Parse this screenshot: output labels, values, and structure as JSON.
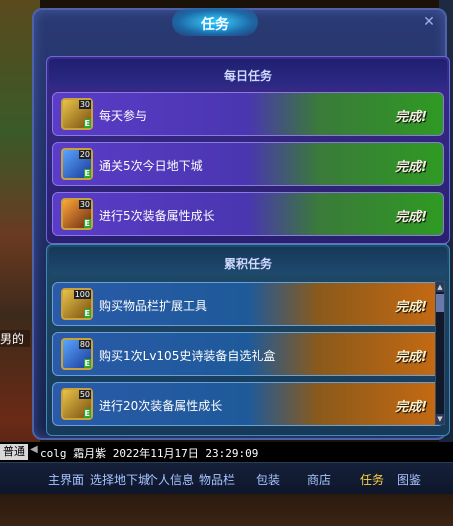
{
  "background": {
    "side_text": "男的"
  },
  "window": {
    "title": "任务"
  },
  "daily": {
    "title": "每日任务",
    "tasks": [
      {
        "icon": "gold-ticket-icon",
        "count": "30",
        "badge": "E",
        "name": "每天参与",
        "status": "完成!"
      },
      {
        "icon": "blue-crystal-icon",
        "count": "20",
        "badge": "E",
        "name": "通关5次今日地下城",
        "status": "完成!"
      },
      {
        "icon": "orange-armor-icon",
        "count": "30",
        "badge": "E",
        "name": "进行5次装备属性成长",
        "status": "完成!"
      }
    ]
  },
  "cumulative": {
    "title": "累积任务",
    "tasks": [
      {
        "icon": "gold-ticket-icon",
        "count": "100",
        "badge": "E",
        "name": "购买物品栏扩展工具",
        "status": "完成!"
      },
      {
        "icon": "blue-crystal-icon",
        "count": "80",
        "badge": "E",
        "name": "购买1次Lv105史诗装备自选礼盒",
        "status": "完成!"
      },
      {
        "icon": "gold-ticket-icon",
        "count": "50",
        "badge": "E",
        "name": "进行20次装备属性成长",
        "status": "完成!"
      }
    ]
  },
  "chat": {
    "channel": "普通",
    "text": "colg 霜月紫  2022年11月17日 23:29:09"
  },
  "nav": [
    "主界面",
    "选择地下城",
    "个人信息",
    "物品栏",
    "包装",
    "商店",
    "任务",
    "图鉴"
  ],
  "active_nav": "任务",
  "colors": {
    "complete_green": "#2f9a22",
    "complete_orange": "#c86a12",
    "active_tab": "#ffd040"
  }
}
